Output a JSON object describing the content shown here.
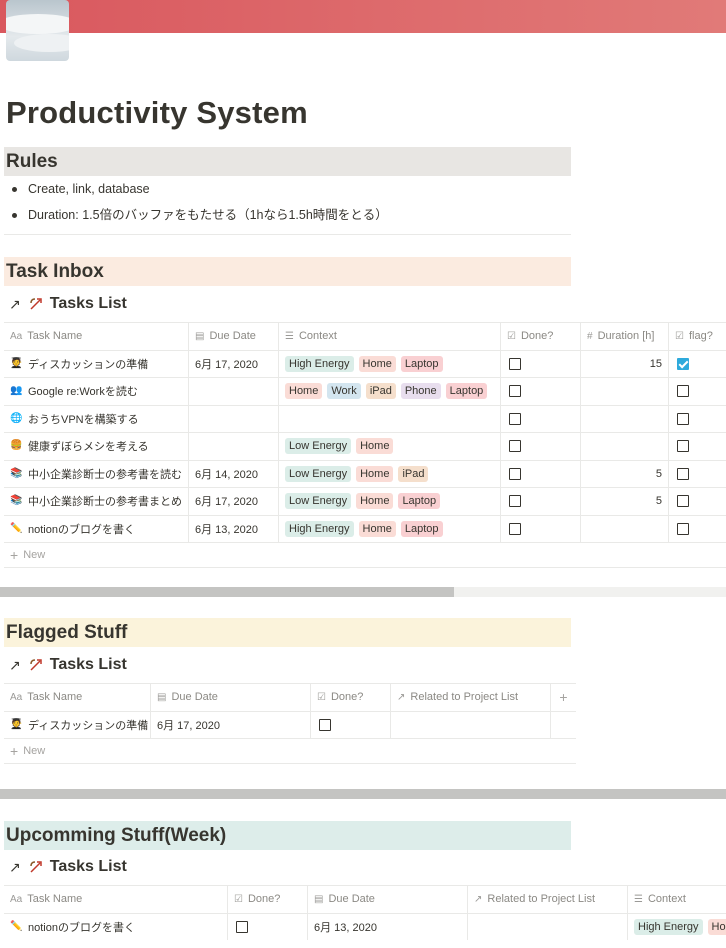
{
  "page": {
    "title": "Productivity System",
    "icon": "clouds-icon"
  },
  "rules": {
    "heading": "Rules",
    "bullets": [
      "Create, link, database",
      "Duration: 1.5倍のバッファをもたせる（1hなら1.5h時間をとる）"
    ]
  },
  "colors": {
    "rules_bg": "#e8e6e3",
    "inbox_bg": "#fbebe0",
    "flagged_bg": "#fbf3db",
    "upcoming_bg": "#ddedea",
    "cover": "#e17a78"
  },
  "tag_colors": {
    "High Energy": "#dbede8",
    "Home": "#fadcd6",
    "Laptop": "#f9d0d2",
    "Work": "#d3e5ef",
    "iPad": "#f5dfcc",
    "Phone": "#e8deee",
    "Low Energy": "#dbede8"
  },
  "inbox": {
    "heading": "Task Inbox",
    "db_title": "Tasks List",
    "columns": [
      "Task Name",
      "Due Date",
      "Context",
      "Done?",
      "Duration [h]",
      "flag?"
    ],
    "rows": [
      {
        "icon": "🧑‍🎓",
        "name": "ディスカッションの準備",
        "due": "6月 17, 2020",
        "context": [
          "High Energy",
          "Home",
          "Laptop"
        ],
        "done": false,
        "duration": "15",
        "flag": true
      },
      {
        "icon": "👥",
        "name": "Google re:Workを読む",
        "due": "",
        "context": [
          "Home",
          "Work",
          "iPad",
          "Phone",
          "Laptop"
        ],
        "done": false,
        "duration": "",
        "flag": false
      },
      {
        "icon": "🌐",
        "name": "おうちVPNを構築する",
        "due": "",
        "context": [],
        "done": false,
        "duration": "",
        "flag": false
      },
      {
        "icon": "🍔",
        "name": "健康ずぼらメシを考える",
        "due": "",
        "context": [
          "Low Energy",
          "Home"
        ],
        "done": false,
        "duration": "",
        "flag": false
      },
      {
        "icon": "📚",
        "name": "中小企業診断士の参考書を読む",
        "due": "6月 14, 2020",
        "context": [
          "Low Energy",
          "Home",
          "iPad"
        ],
        "done": false,
        "duration": "5",
        "flag": false
      },
      {
        "icon": "📚",
        "name": "中小企業診断士の参考書まとめ",
        "due": "6月 17, 2020",
        "context": [
          "Low Energy",
          "Home",
          "Laptop"
        ],
        "done": false,
        "duration": "5",
        "flag": false
      },
      {
        "icon": "✏️",
        "name": "notionのブログを書く",
        "due": "6月 13, 2020",
        "context": [
          "High Energy",
          "Home",
          "Laptop"
        ],
        "done": false,
        "duration": "",
        "flag": false
      }
    ],
    "new_label": "New"
  },
  "flagged": {
    "heading": "Flagged Stuff",
    "db_title": "Tasks List",
    "columns": [
      "Task Name",
      "Due Date",
      "Done?",
      "Related to Project List"
    ],
    "add_column": "+",
    "rows": [
      {
        "icon": "🧑‍🎓",
        "name": "ディスカッションの準備",
        "due": "6月 17, 2020",
        "done": false,
        "related": ""
      }
    ],
    "new_label": "New"
  },
  "upcoming": {
    "heading": "Upcomming Stuff(Week)",
    "db_title": "Tasks List",
    "columns": [
      "Task Name",
      "Done?",
      "Due Date",
      "Related to Project List",
      "Context"
    ],
    "rows": [
      {
        "icon": "✏️",
        "name": "notionのブログを書く",
        "done": false,
        "due": "6月 13, 2020",
        "related": "",
        "context": [
          "High Energy",
          "Home"
        ]
      }
    ]
  }
}
